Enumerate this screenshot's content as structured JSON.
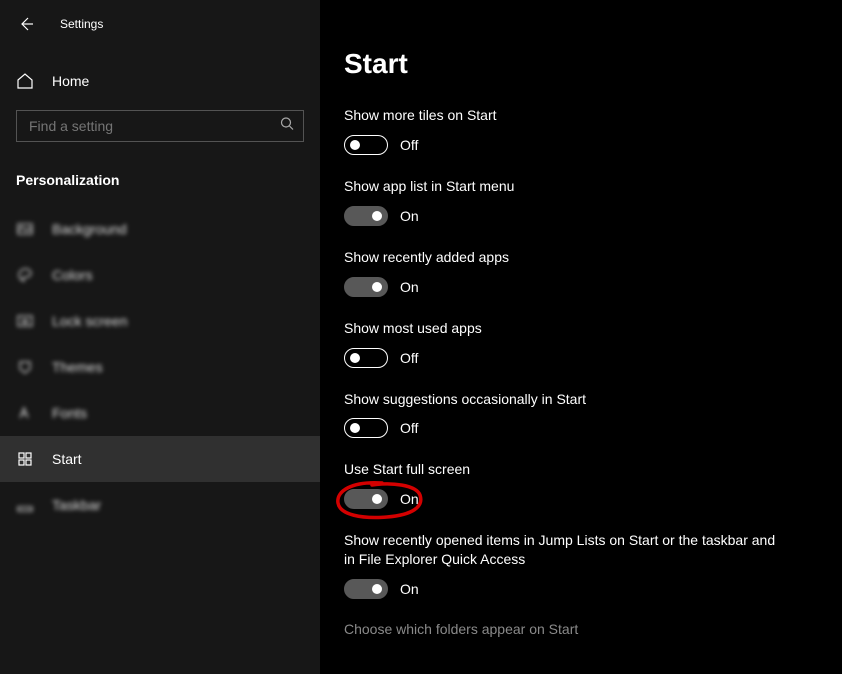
{
  "header": {
    "settings_label": "Settings"
  },
  "home_label": "Home",
  "search": {
    "placeholder": "Find a setting"
  },
  "section_title": "Personalization",
  "nav": {
    "background": "Background",
    "colors": "Colors",
    "lock_screen": "Lock screen",
    "themes": "Themes",
    "fonts": "Fonts",
    "start": "Start",
    "taskbar": "Taskbar"
  },
  "page": {
    "title": "Start",
    "settings": [
      {
        "label": "Show more tiles on Start",
        "state": "Off",
        "on": false
      },
      {
        "label": "Show app list in Start menu",
        "state": "On",
        "on": true
      },
      {
        "label": "Show recently added apps",
        "state": "On",
        "on": true
      },
      {
        "label": "Show most used apps",
        "state": "Off",
        "on": false
      },
      {
        "label": "Show suggestions occasionally in Start",
        "state": "Off",
        "on": false
      },
      {
        "label": "Use Start full screen",
        "state": "On",
        "on": true
      },
      {
        "label": "Show recently opened items in Jump Lists on Start or the taskbar and in File Explorer Quick Access",
        "state": "On",
        "on": true
      }
    ],
    "link": "Choose which folders appear on Start"
  }
}
